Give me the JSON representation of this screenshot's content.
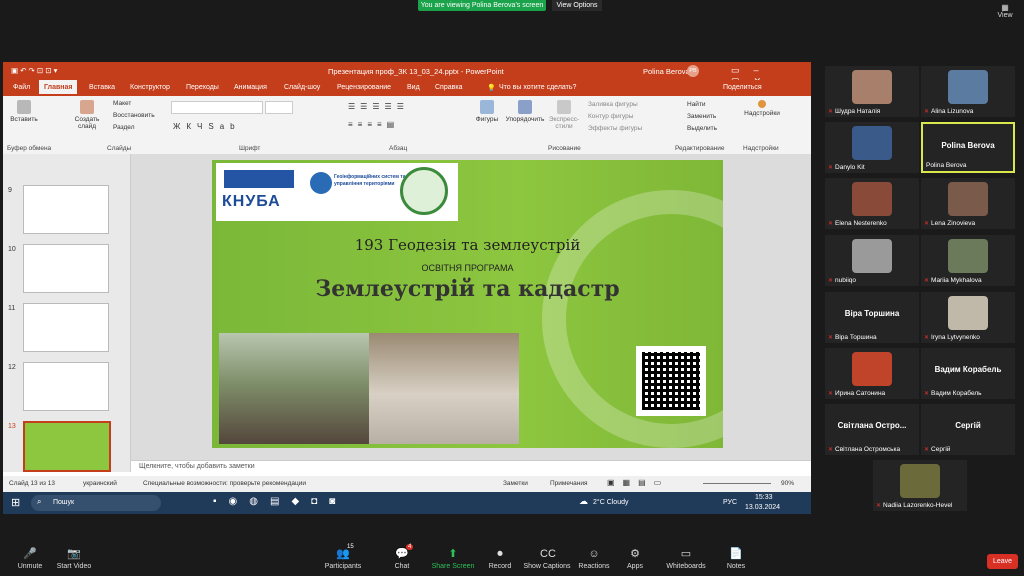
{
  "zoom": {
    "banner": "You are viewing Polina Berova's screen",
    "view_options": "View Options",
    "view": "View",
    "toolbar": [
      {
        "label": "Unmute",
        "icon": "mic-off-icon",
        "glyph": "🎤"
      },
      {
        "label": "Start Video",
        "icon": "video-off-icon",
        "glyph": "📷"
      },
      {
        "label": "Participants",
        "icon": "participants-icon",
        "glyph": "👥",
        "badge": "15"
      },
      {
        "label": "Chat",
        "icon": "chat-icon",
        "glyph": "💬",
        "badge": "4"
      },
      {
        "label": "Share Screen",
        "icon": "share-screen-icon",
        "glyph": "⬆"
      },
      {
        "label": "Record",
        "icon": "record-icon",
        "glyph": "⏺"
      },
      {
        "label": "Show Captions",
        "icon": "captions-icon",
        "glyph": "CC"
      },
      {
        "label": "Reactions",
        "icon": "reactions-icon",
        "glyph": "☺"
      },
      {
        "label": "Apps",
        "icon": "apps-icon",
        "glyph": "⚙"
      },
      {
        "label": "Whiteboards",
        "icon": "whiteboard-icon",
        "glyph": "▭"
      },
      {
        "label": "Notes",
        "icon": "notes-icon",
        "glyph": "📄"
      }
    ],
    "leave": "Leave",
    "participants": [
      {
        "name": "Шудра Наталія",
        "face": "#a87f6a"
      },
      {
        "name": "Alina Lizunova",
        "face": "#5b7ca0"
      },
      {
        "name": "Danylo Kit",
        "face": "#3a5a8a"
      },
      {
        "name": "Polina Berova",
        "big": "Polina Berova",
        "active": true
      },
      {
        "name": "Elena Nesterenko",
        "face": "#8a4a3a"
      },
      {
        "name": "Lena Zinovieva",
        "face": "#7a5a4a"
      },
      {
        "name": "nubiiqo",
        "face": "#9a9a9a"
      },
      {
        "name": "Mariia Mykhalova",
        "face": "#6a7a5a"
      },
      {
        "name": "Віра Торшина",
        "big": "Віра Торшина"
      },
      {
        "name": "Iryna Lytvynenko",
        "face": "#c0b8a8"
      },
      {
        "name": "Ирина Сатонина",
        "face": "#c0442a"
      },
      {
        "name": "Вадим Корабель",
        "big": "Вадим Корабель"
      },
      {
        "name": "Світлана Остромська",
        "big": "Світлана  Остро..."
      },
      {
        "name": "Сергій",
        "big": "Сергій"
      },
      {
        "name": "Nadiia Lazorenko-Hevel",
        "face": "#6a6a3a"
      }
    ]
  },
  "ppt": {
    "window_title": "Презентация проф_ЗК 13_03_24.pptx  -  PowerPoint",
    "user": "Polina Berova",
    "user_initials": "PB",
    "tabs": [
      "Файл",
      "Главная",
      "Вставка",
      "Конструктор",
      "Переходы",
      "Анимация",
      "Слайд-шоу",
      "Рецензирование",
      "Вид",
      "Справка"
    ],
    "tell_me": "Что вы хотите сделать?",
    "share": "Поделиться",
    "groups": [
      "Буфер обмена",
      "Слайды",
      "Шрифт",
      "Абзац",
      "Рисование",
      "Редактирование",
      "Надстройки"
    ],
    "buttons": {
      "paste": "Вставить",
      "new_slide": "Создать слайд",
      "layout": "Макет",
      "reset": "Восстановить",
      "section": "Раздел",
      "shapes": "Фигуры",
      "arrange": "Упорядочить",
      "quick_styles": "Экспресс-стили",
      "fill": "Заливка фигуры",
      "outline": "Контур фигуры",
      "effects": "Эффекты фигуры",
      "find": "Найти",
      "replace": "Заменить",
      "select": "Выделить",
      "addins": "Надстройки"
    },
    "thumb_numbers": [
      "9",
      "10",
      "11",
      "12",
      "13"
    ],
    "slide": {
      "logo_text": "КНУБА",
      "dept_text": "Геоінформаційних систем та управління територіями",
      "line1": "193 Геодезія та землеустрій",
      "line2": "ОСВІТНЯ ПРОГРАМА",
      "line3": "Землеустрій та кадастр"
    },
    "notes_placeholder": "Щелкните, чтобы добавить заметки",
    "status": {
      "slide": "Слайд 13 из 13",
      "lang": "украинский",
      "accessibility": "Специальные возможности: проверьте рекомендации",
      "notes": "Заметки",
      "comments": "Примечания",
      "zoom": "90%"
    }
  },
  "taskbar": {
    "search": "Пошук",
    "weather": "2°C  Cloudy",
    "lang": "РУС",
    "time": "15:33",
    "date": "13.03.2024"
  }
}
